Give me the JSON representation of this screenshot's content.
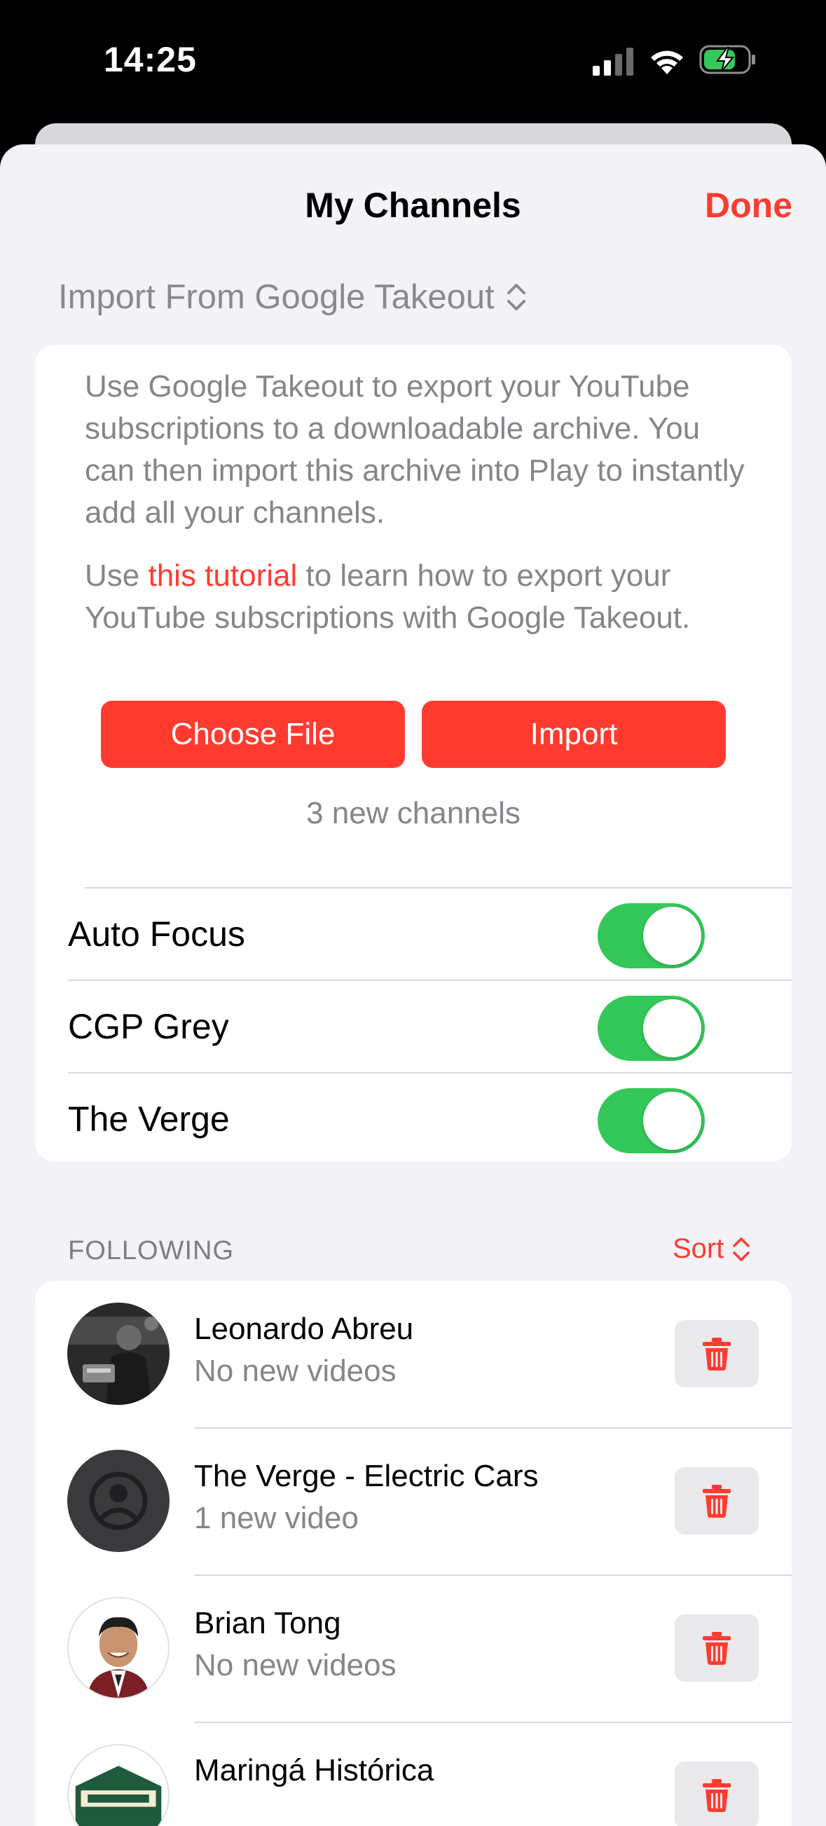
{
  "status_bar": {
    "time": "14:25"
  },
  "nav": {
    "title": "My Channels",
    "done_label": "Done"
  },
  "import_source": {
    "selected": "Import From Google Takeout"
  },
  "import_panel": {
    "description": "Use Google Takeout to export your YouTube subscriptions to a downloadable archive. You can then import this archive into Play to instantly add all your channels.",
    "tutorial_prefix": "Use ",
    "tutorial_link": "this tutorial",
    "tutorial_suffix": " to learn how to export your YouTube subscriptions with Google Takeout.",
    "choose_file_label": "Choose File",
    "import_label": "Import",
    "new_channels_count": "3 new channels",
    "channels": [
      {
        "name": "Auto Focus",
        "enabled": true
      },
      {
        "name": "CGP Grey",
        "enabled": true
      },
      {
        "name": "The Verge",
        "enabled": true
      }
    ]
  },
  "following": {
    "header": "FOLLOWING",
    "sort_label": "Sort",
    "items": [
      {
        "name": "Leonardo Abreu",
        "status": "No new videos",
        "avatar": "photo-avatar"
      },
      {
        "name": "The Verge - Electric Cars",
        "status": "1 new video",
        "avatar": "placeholder-avatar"
      },
      {
        "name": "Brian Tong",
        "status": "No new videos",
        "avatar": "photo-avatar"
      },
      {
        "name": "Maringá Histórica",
        "status": "",
        "avatar": "logo-avatar"
      }
    ]
  },
  "colors": {
    "accent": "#ff3b30",
    "toggle_on": "#34c759",
    "background": "#f2f2f7"
  }
}
